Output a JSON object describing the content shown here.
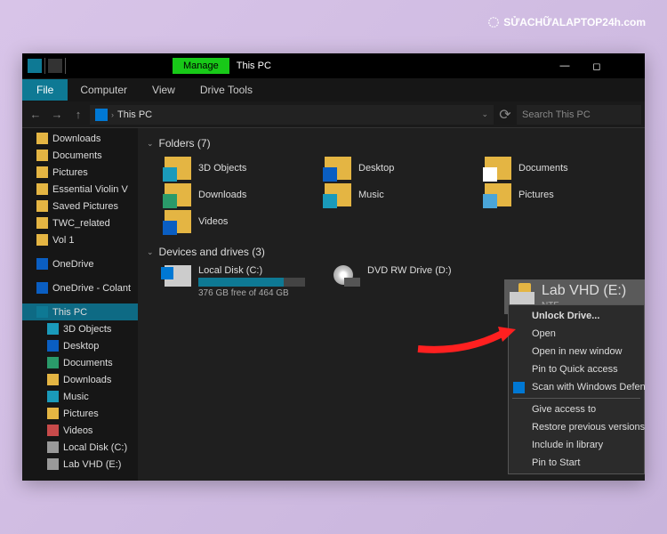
{
  "watermark": "SỬACHỮALAPTOP24h.com",
  "titlebar": {
    "manage_label": "Manage",
    "title": "This PC"
  },
  "ribbon": {
    "file": "File",
    "tabs": [
      "Computer",
      "View",
      "Drive Tools"
    ]
  },
  "addressbar": {
    "location": "This PC",
    "search_placeholder": "Search This PC"
  },
  "sidebar": {
    "items": [
      {
        "label": "Downloads",
        "icon": "ico-dl"
      },
      {
        "label": "Documents",
        "icon": "ico-folder"
      },
      {
        "label": "Pictures",
        "icon": "ico-pic"
      },
      {
        "label": "Essential Violin V",
        "icon": "ico-folder"
      },
      {
        "label": "Saved Pictures",
        "icon": "ico-folder"
      },
      {
        "label": "TWC_related",
        "icon": "ico-folder"
      },
      {
        "label": "Vol 1",
        "icon": "ico-folder"
      },
      {
        "label": "OneDrive",
        "icon": "ico-onedrive",
        "gap": true
      },
      {
        "label": "OneDrive - Colant",
        "icon": "ico-onedrive",
        "gap": true
      },
      {
        "label": "This PC",
        "icon": "ico-thispc",
        "selected": true,
        "gap": true
      },
      {
        "label": "3D Objects",
        "icon": "ico-3d",
        "indent": true
      },
      {
        "label": "Desktop",
        "icon": "ico-desktop",
        "indent": true
      },
      {
        "label": "Documents",
        "icon": "ico-doc",
        "indent": true
      },
      {
        "label": "Downloads",
        "icon": "ico-dl",
        "indent": true
      },
      {
        "label": "Music",
        "icon": "ico-music",
        "indent": true
      },
      {
        "label": "Pictures",
        "icon": "ico-pic",
        "indent": true
      },
      {
        "label": "Videos",
        "icon": "ico-video",
        "indent": true
      },
      {
        "label": "Local Disk (C:)",
        "icon": "ico-disk",
        "indent": true
      },
      {
        "label": "Lab VHD (E:)",
        "icon": "ico-disk",
        "indent": true
      }
    ]
  },
  "main": {
    "folders_header": "Folders (7)",
    "folders": [
      {
        "label": "3D Objects",
        "overlay": "ov-3d"
      },
      {
        "label": "Desktop",
        "overlay": "ov-desktop"
      },
      {
        "label": "Documents",
        "overlay": "ov-doc"
      },
      {
        "label": "Downloads",
        "overlay": "ov-dl"
      },
      {
        "label": "Music",
        "overlay": "ov-music"
      },
      {
        "label": "Pictures",
        "overlay": "ov-pic"
      },
      {
        "label": "Videos",
        "overlay": "ov-video"
      }
    ],
    "drives_header": "Devices and drives (3)",
    "drives": {
      "c": {
        "label": "Local Disk (C:)",
        "free": "376 GB free of 464 GB"
      },
      "dvd": {
        "label": "DVD RW Drive (D:)"
      },
      "locked": {
        "label": "Lab VHD (E:)",
        "sub": "NTF"
      }
    }
  },
  "context_menu": {
    "items": [
      {
        "label": "Unlock Drive...",
        "bold": true
      },
      {
        "label": "Open"
      },
      {
        "label": "Open in new window"
      },
      {
        "label": "Pin to Quick access"
      },
      {
        "label": "Scan with Windows Defen",
        "icon": "shield"
      },
      {
        "sep": true
      },
      {
        "label": "Give access to",
        "sub": true
      },
      {
        "label": "Restore previous versions"
      },
      {
        "label": "Include in library",
        "sub": true
      },
      {
        "label": "Pin to Start"
      }
    ]
  }
}
